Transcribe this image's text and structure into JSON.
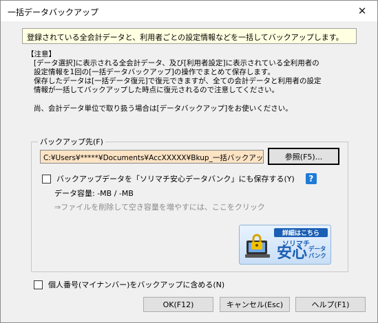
{
  "window": {
    "title": "一括データバックアップ",
    "close_label": "✕"
  },
  "banner": {
    "text": "登録されている全会計データと、利用者ごとの設定情報などを一括してバックアップします。"
  },
  "notes": {
    "heading": "【注意】",
    "lines": [
      "[データ選択]に表示される全会計データ、及び[利用者設定]に表示されている全利用者の",
      "設定情報を1回の[一括データバックアップ]の操作でまとめて保存します。",
      "保存したデータは[一括データ復元]で復元できますが、全ての会計データと利用者の設定",
      "情報が一括してバックアップした時点に復元されるので注意してください。"
    ],
    "footer": "尚、会計データ単位で取り扱う場合は[データバックアップ]をお使いください。"
  },
  "backup_dest": {
    "legend": "バックアップ先(F)",
    "path": "C:¥Users¥*****¥Documents¥AccXXXXX¥Bkup_一括バックアップ",
    "browse_label": "参照(F5)..."
  },
  "bank_option": {
    "label": "バックアップデータを「ソリマチ安心データバンク」にも保存する(Y)",
    "help_icon_label": "?",
    "capacity": "データ容量: -MB / -MB",
    "delete_link": "⇒ファイルを削除して空き容量を増やすには、ここをクリック",
    "logo": {
      "tag": "詳細はこちら",
      "brand1": "ソリマチ",
      "brand2": "安心",
      "brand3_line1": "データ",
      "brand3_line2": "バンク"
    }
  },
  "mynumber_option": {
    "label": "個人番号(マイナンバー)をバックアップに含める(N)"
  },
  "buttons": {
    "ok": "OK(F12)",
    "cancel": "キャンセル(Esc)",
    "help": "ヘルプ(F1)"
  },
  "colors": {
    "banner_bg": "#ffffe1",
    "path_bg": "#fbe3c4",
    "accent_blue": "#1a5fb4"
  }
}
